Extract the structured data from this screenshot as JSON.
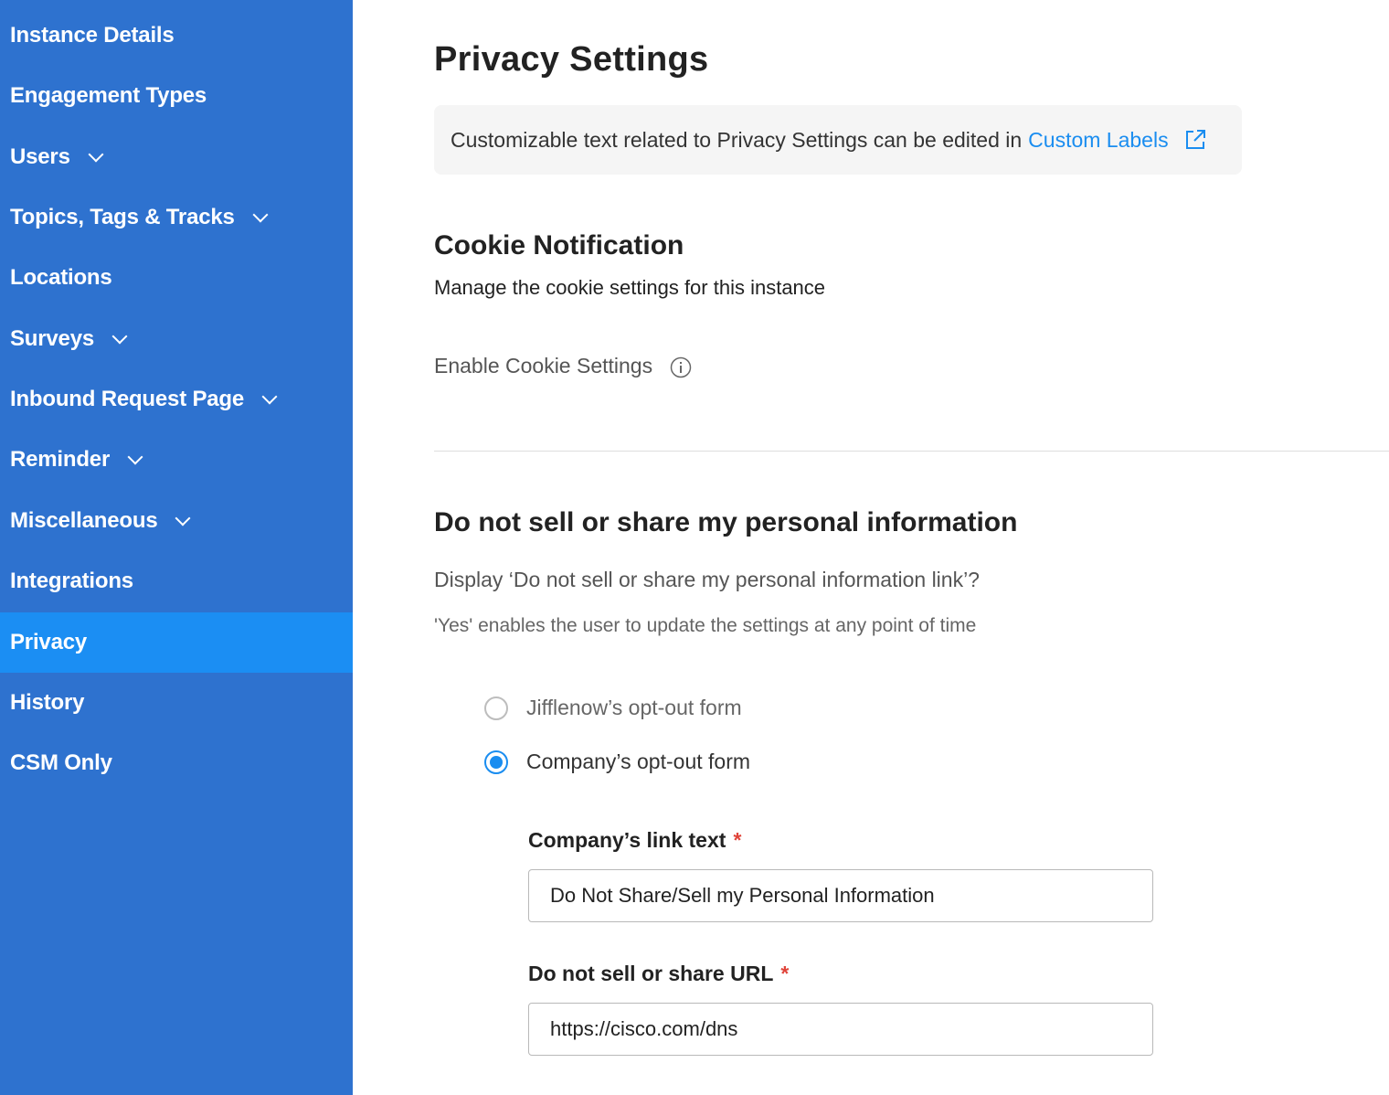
{
  "colors": {
    "sidebar_bg": "#2e72cf",
    "sidebar_active_bg": "#1b8ef3",
    "link": "#1a8df0",
    "required": "#e0443a"
  },
  "sidebar": {
    "items": [
      {
        "label": "Instance Details",
        "expandable": false
      },
      {
        "label": "Engagement Types",
        "expandable": false
      },
      {
        "label": "Users",
        "expandable": true
      },
      {
        "label": "Topics, Tags & Tracks",
        "expandable": true
      },
      {
        "label": "Locations",
        "expandable": false
      },
      {
        "label": "Surveys",
        "expandable": true
      },
      {
        "label": "Inbound Request Page",
        "expandable": true
      },
      {
        "label": "Reminder",
        "expandable": true
      },
      {
        "label": "Miscellaneous",
        "expandable": true
      },
      {
        "label": "Integrations",
        "expandable": false
      },
      {
        "label": "Privacy",
        "expandable": false,
        "active": true
      },
      {
        "label": "History",
        "expandable": false
      },
      {
        "label": "CSM Only",
        "expandable": false
      }
    ]
  },
  "main": {
    "title": "Privacy Settings",
    "banner": {
      "text": "Customizable text related to Privacy Settings can be edited in",
      "link_label": "Custom Labels",
      "link_icon": "external-link-icon"
    },
    "cookie": {
      "title": "Cookie Notification",
      "description": "Manage the cookie settings for this instance",
      "enable_label": "Enable Cookie Settings",
      "info_icon": "info-icon"
    },
    "dns": {
      "title": "Do not sell or share my personal information",
      "question": "Display ‘Do not sell or share my personal information link’?",
      "hint": "'Yes' enables the user to update the settings at any point of time",
      "options": [
        {
          "label": "Jifflenow’s opt-out form",
          "checked": false
        },
        {
          "label": "Company’s opt-out form",
          "checked": true
        }
      ],
      "link_text_label": "Company’s link text",
      "link_text_value": "Do Not Share/Sell my Personal Information",
      "url_label": "Do not sell or share URL",
      "url_value": "https://cisco.com/dns",
      "required_mark": "*"
    }
  }
}
